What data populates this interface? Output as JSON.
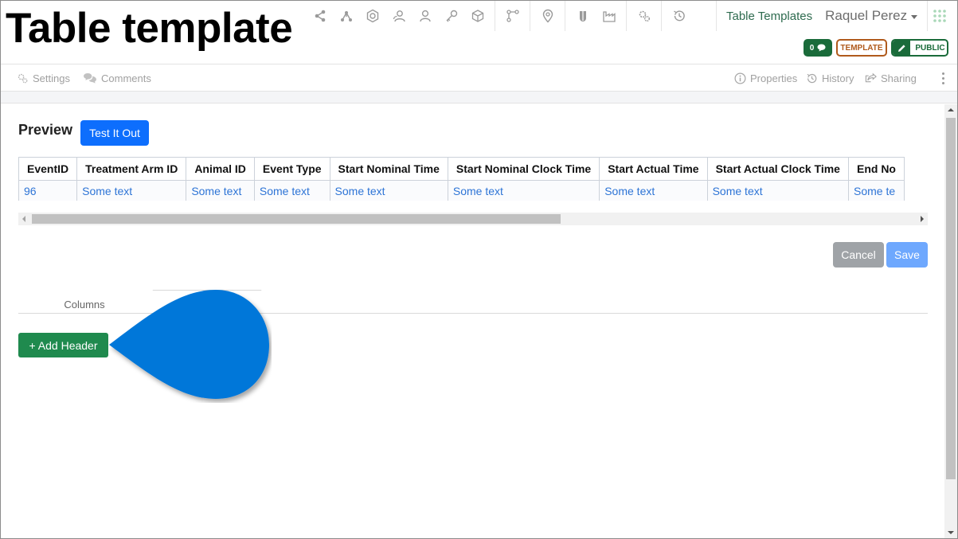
{
  "page": {
    "title": "Table template"
  },
  "toolbar": {
    "icons": [
      "share-icon",
      "network-icon",
      "hexagon-icon",
      "users-icon",
      "user-icon",
      "key-icon",
      "cube-icon",
      "branch-icon",
      "map-pin-icon",
      "flask-icon",
      "factory-icon",
      "gears-icon",
      "history-icon"
    ]
  },
  "nav": {
    "link": "Table Templates",
    "user": "Raquel Perez"
  },
  "badges": {
    "comment_count": "0",
    "template": "TEMPLATE",
    "public": "PUBLIC"
  },
  "subnav": {
    "settings": "Settings",
    "comments": "Comments",
    "properties": "Properties",
    "history": "History",
    "sharing": "Sharing"
  },
  "preview": {
    "label": "Preview",
    "test_button": "Test It Out",
    "columns": [
      "EventID",
      "Treatment Arm ID",
      "Animal ID",
      "Event Type",
      "Start Nominal Time",
      "Start Nominal Clock Time",
      "Start Actual Time",
      "Start Actual Clock Time",
      "End No"
    ],
    "rows": [
      [
        "96",
        "Some text",
        "Some text",
        "Some text",
        "Some text",
        "Some text",
        "Some text",
        "Some text",
        "Some te"
      ]
    ]
  },
  "actions": {
    "cancel": "Cancel",
    "save": "Save"
  },
  "tabs": {
    "columns": "Columns"
  },
  "add_header_button": "+ Add Header",
  "colors": {
    "primary": "#0d6efd",
    "success": "#1f8a4e",
    "pointer": "#0277d9",
    "template": "#b05a1c"
  }
}
